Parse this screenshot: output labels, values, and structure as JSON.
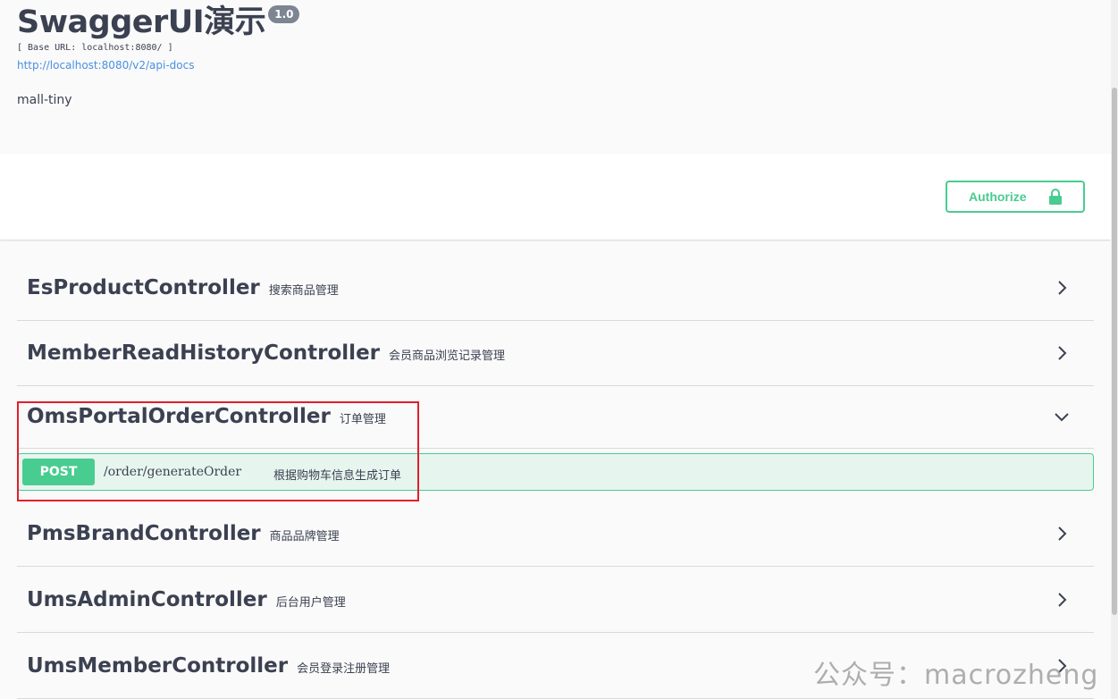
{
  "info": {
    "title": "SwaggerUI演示",
    "version": "1.0",
    "base_url": "[ Base URL: localhost:8080/ ]",
    "docs_link": "http://localhost:8080/v2/api-docs",
    "description": "mall-tiny"
  },
  "authorize": {
    "label": "Authorize",
    "icon": "lock-icon"
  },
  "tags": [
    {
      "name": "EsProductController",
      "description": "搜索商品管理",
      "expanded": false
    },
    {
      "name": "MemberReadHistoryController",
      "description": "会员商品浏览记录管理",
      "expanded": false
    },
    {
      "name": "OmsPortalOrderController",
      "description": "订单管理",
      "expanded": true
    },
    {
      "name": "PmsBrandController",
      "description": "商品品牌管理",
      "expanded": false
    },
    {
      "name": "UmsAdminController",
      "description": "后台用户管理",
      "expanded": false
    },
    {
      "name": "UmsMemberController",
      "description": "会员登录注册管理",
      "expanded": false
    }
  ],
  "operation": {
    "method": "POST",
    "path": "/order/generateOrder",
    "summary": "根据购物车信息生成订单"
  },
  "colors": {
    "post": "#49cc90",
    "highlight": "#e0202a",
    "text": "#3b4151",
    "link": "#4990e2"
  },
  "watermark": "公众号：macrozheng"
}
